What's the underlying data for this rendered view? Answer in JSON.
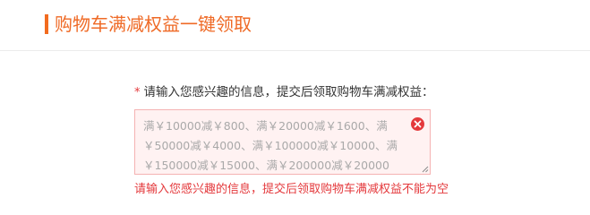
{
  "header": {
    "title": "购物车满减权益一键领取"
  },
  "form": {
    "label": "请输入您感兴趣的信息，提交后领取购物车满减权益：",
    "required_mark": "*",
    "textarea": {
      "value": "",
      "placeholder": "满￥10000减￥800、满￥20000减￥1600、满￥50000减￥4000、满￥100000减￥10000、满￥150000减￥15000、满￥200000减￥20000"
    },
    "error": "请输入您感兴趣的信息，提交后领取购物车满减权益不能为空"
  },
  "colors": {
    "accent": "#f26b1f",
    "title": "#ef6a26",
    "error": "#e4393c",
    "field_error_bg": "#fff2f2",
    "field_error_border": "#f5b3b3"
  },
  "icons": {
    "clear": "close-circle-icon",
    "resize": "resize-handle-icon"
  }
}
